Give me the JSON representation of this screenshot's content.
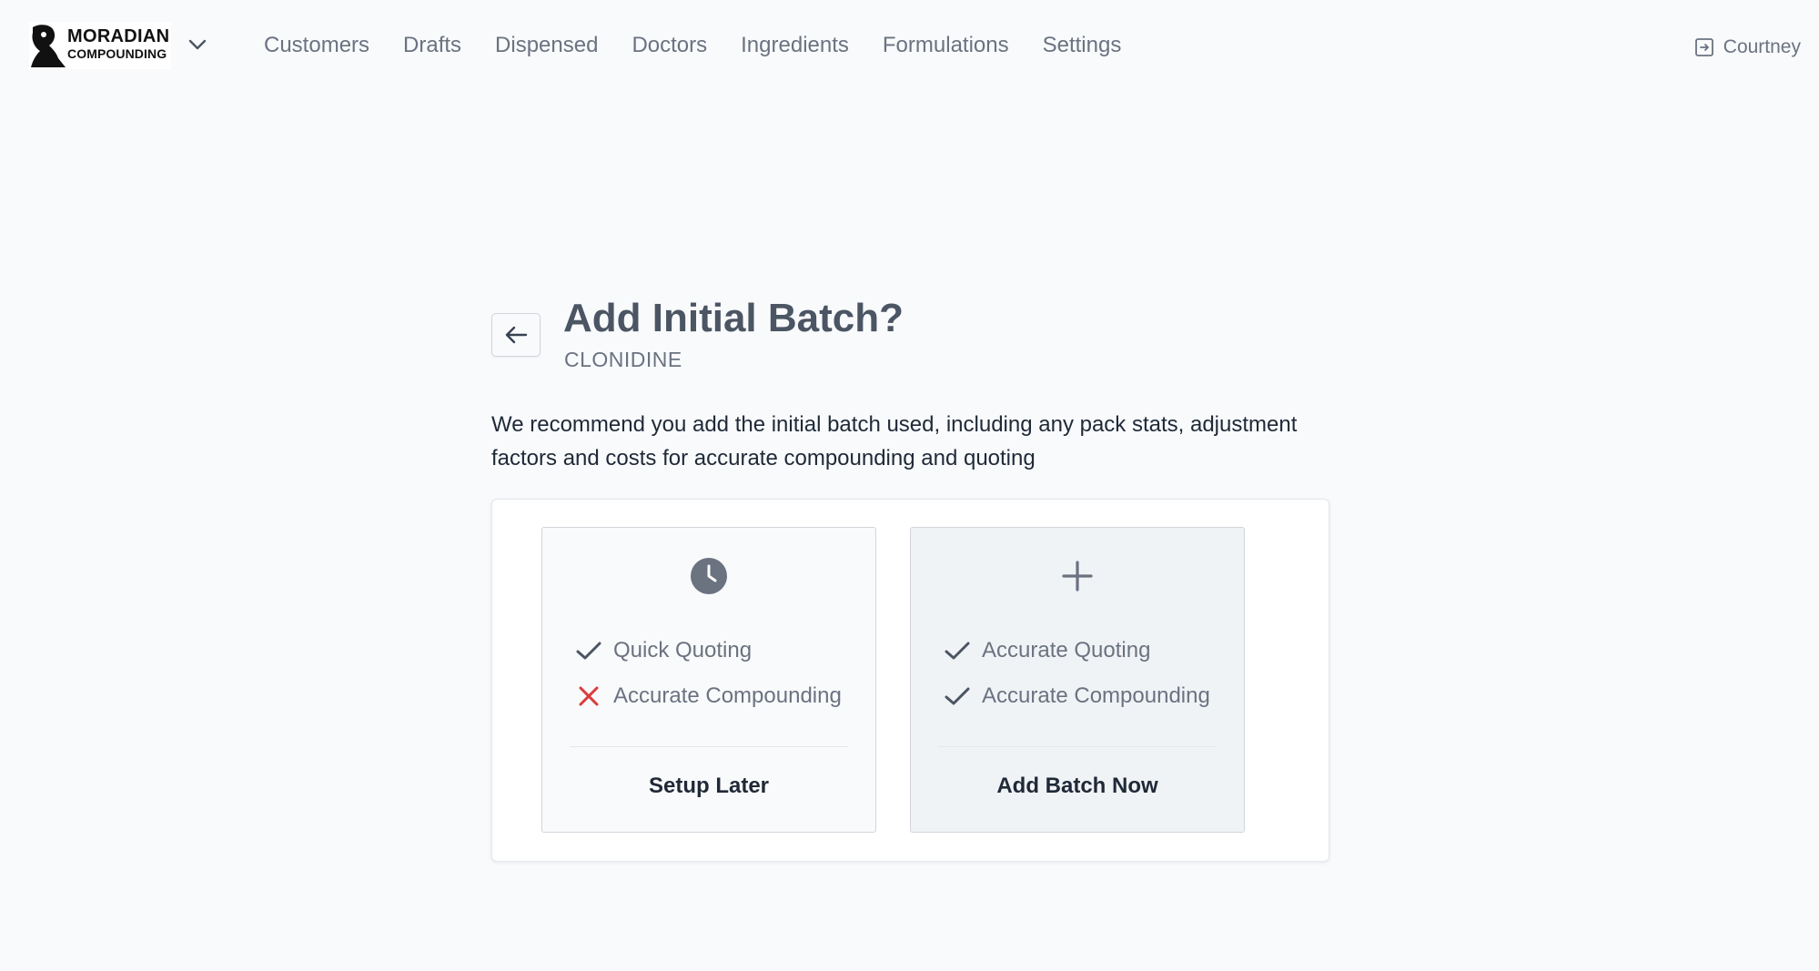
{
  "brand": {
    "line1": "MORADIAN",
    "line2": "COMPOUNDING",
    "logo_icon": "moradian-logo-icon",
    "menu_icon": "chevron-down-icon"
  },
  "nav": {
    "items": [
      "Customers",
      "Drafts",
      "Dispensed",
      "Doctors",
      "Ingredients",
      "Formulations",
      "Settings"
    ]
  },
  "user": {
    "name": "Courtney",
    "icon": "logout-icon"
  },
  "page": {
    "back_icon": "arrow-left-icon",
    "title": "Add Initial Batch?",
    "subtitle": "CLONIDINE",
    "description": "We recommend you add the initial batch used, including any pack stats, adjustment factors and costs for accurate compounding and quoting"
  },
  "options": [
    {
      "icon": "clock-icon",
      "features": [
        {
          "label": "Quick Quoting",
          "status": "check"
        },
        {
          "label": "Accurate Compounding",
          "status": "cross"
        }
      ],
      "label": "Setup Later"
    },
    {
      "icon": "plus-icon",
      "features": [
        {
          "label": "Accurate Quoting",
          "status": "check"
        },
        {
          "label": "Accurate Compounding",
          "status": "check"
        }
      ],
      "label": "Add Batch Now"
    }
  ],
  "colors": {
    "background": "#f8fafc",
    "check": "#4b5563",
    "cross": "#dc3b3b",
    "muted_text": "#6b7280"
  }
}
